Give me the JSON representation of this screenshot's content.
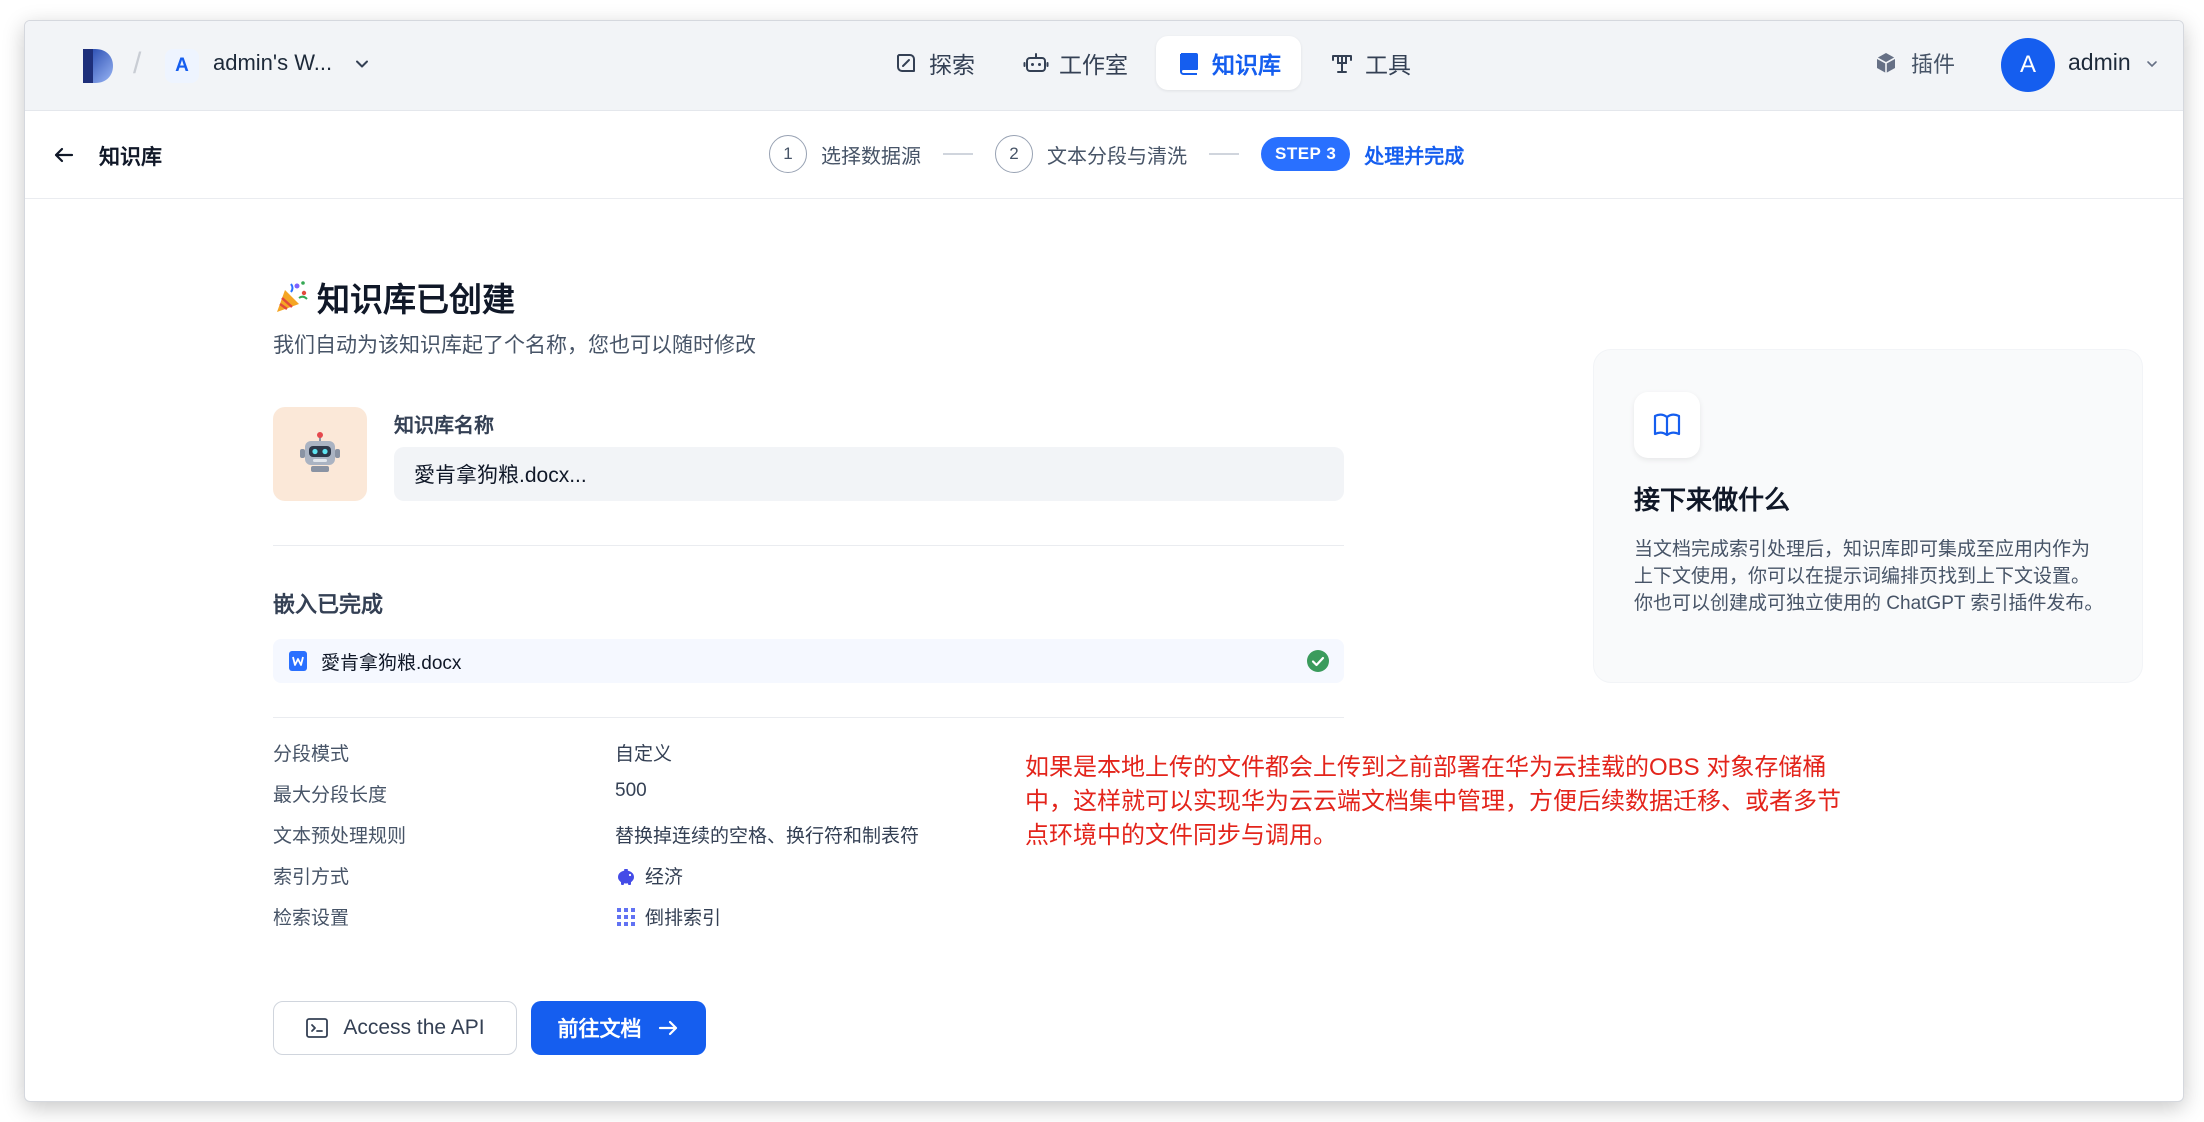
{
  "header": {
    "workspace_initial": "A",
    "workspace_name": "admin's W...",
    "nav": [
      {
        "label": "探索",
        "icon": "explore-icon"
      },
      {
        "label": "工作室",
        "icon": "robot-icon"
      },
      {
        "label": "知识库",
        "icon": "book-icon",
        "active": true
      },
      {
        "label": "工具",
        "icon": "tools-icon"
      }
    ],
    "plugins_label": "插件",
    "user_initial": "A",
    "user_name": "admin"
  },
  "stepbar": {
    "back_label": "知识库",
    "steps": [
      {
        "num": "1",
        "label": "选择数据源"
      },
      {
        "num": "2",
        "label": "文本分段与清洗"
      },
      {
        "num": "STEP 3",
        "label": "处理并完成",
        "active": true
      }
    ]
  },
  "main": {
    "title": "知识库已创建",
    "subtitle": "我们自动为该知识库起了个名称，您也可以随时修改",
    "name_label": "知识库名称",
    "name_value": "愛肯拿狗粮.docx...",
    "embed_title": "嵌入已完成",
    "file_name": "愛肯拿狗粮.docx",
    "info": [
      {
        "key": "分段模式",
        "value": "自定义"
      },
      {
        "key": "最大分段长度",
        "value": "500"
      },
      {
        "key": "文本预处理规则",
        "value": "替换掉连续的空格、换行符和制表符"
      },
      {
        "key": "索引方式",
        "value": "经济",
        "icon": "piggy-bank-icon"
      },
      {
        "key": "检索设置",
        "value": "倒排索引",
        "icon": "grid-icon"
      }
    ],
    "api_button": "Access the API",
    "docs_button": "前往文档"
  },
  "next_card": {
    "title": "接下来做什么",
    "description": "当文档完成索引处理后，知识库即可集成至应用内作为上下文使用，你可以在提示词编排页找到上下文设置。你也可以创建成可独立使用的 ChatGPT 索引插件发布。"
  },
  "annotation": "如果是本地上传的文件都会上传到之前部署在华为云挂载的OBS 对象存储桶中，这样就可以实现华为云云端文档集中管理，方便后续数据迁移、或者多节点环境中的文件同步与调用。",
  "colors": {
    "primary": "#155eef",
    "annotation": "#e3241b",
    "success": "#3a9b5c"
  }
}
